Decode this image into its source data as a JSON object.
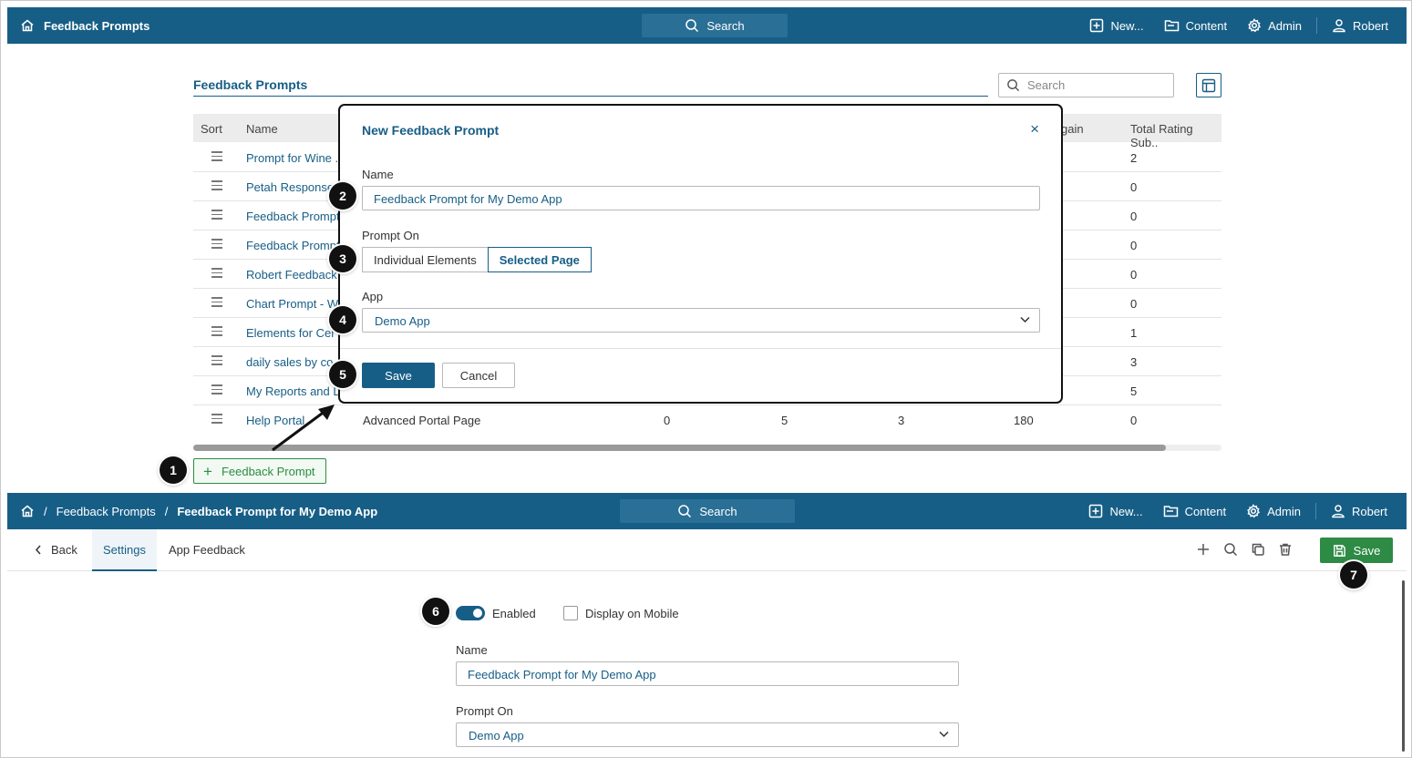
{
  "top_nav": {
    "title": "Feedback Prompts",
    "search_label": "Search",
    "new_label": "New...",
    "content_label": "Content",
    "admin_label": "Admin",
    "user_label": "Robert"
  },
  "list_page": {
    "title": "Feedback Prompts",
    "search_placeholder": "Search",
    "columns": {
      "sort": "Sort",
      "name": "Name",
      "again": "gain",
      "total": "Total Rating Sub.."
    },
    "rows": [
      {
        "name": "Prompt for Wine ...",
        "total": "2"
      },
      {
        "name": "Petah Response",
        "total": "0"
      },
      {
        "name": "Feedback Prompt",
        "total": "0"
      },
      {
        "name": "Feedback Prompt",
        "total": "0"
      },
      {
        "name": "Robert Feedback",
        "total": "0"
      },
      {
        "name": "Chart Prompt - W",
        "total": "0"
      },
      {
        "name": "Elements for Cer",
        "total": "1"
      },
      {
        "name": "daily sales by co",
        "total": "3"
      },
      {
        "name": "My Reports and D",
        "total": "5"
      }
    ],
    "last_row": {
      "name": "Help Portal",
      "page": "Advanced Portal Page",
      "v1": "0",
      "v2": "5",
      "v3": "3",
      "v4": "180",
      "total": "0"
    },
    "add_button": "Feedback Prompt"
  },
  "dialog": {
    "title": "New Feedback Prompt",
    "close": "×",
    "name_label": "Name",
    "name_value": "Feedback Prompt for My Demo App",
    "prompt_on_label": "Prompt On",
    "prompt_options": [
      "Individual Elements",
      "Selected Page"
    ],
    "app_label": "App",
    "app_value": "Demo App",
    "save": "Save",
    "cancel": "Cancel"
  },
  "detail_nav": {
    "crumb_1": "Feedback Prompts",
    "separator": "/",
    "crumb_2": "Feedback Prompt for My Demo App",
    "search_label": "Search",
    "new_label": "New...",
    "content_label": "Content",
    "admin_label": "Admin",
    "user_label": "Robert"
  },
  "detail_toolbar": {
    "back": "Back",
    "tab_settings": "Settings",
    "tab_app_feedback": "App Feedback",
    "save": "Save"
  },
  "detail_form": {
    "enabled_label": "Enabled",
    "enabled": true,
    "mobile_label": "Display on Mobile",
    "mobile": false,
    "name_label": "Name",
    "name_value": "Feedback Prompt for My Demo App",
    "prompt_on_label": "Prompt On",
    "prompt_on_value": "Demo App"
  },
  "markers": [
    "1",
    "2",
    "3",
    "4",
    "5",
    "6",
    "7"
  ]
}
